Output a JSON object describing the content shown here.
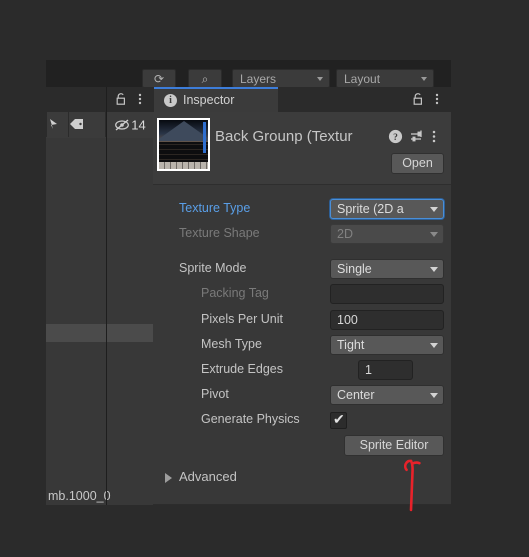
{
  "app": {
    "name": "Unity Editor",
    "background_color": "#2b2b2b",
    "panel_color": "#383838",
    "accent_color": "#3d7dd9"
  },
  "toolbar": {
    "buttons": [
      {
        "name": "cloud-sync-icon",
        "label": "⟳"
      },
      {
        "name": "search-icon",
        "label": "⌕"
      }
    ],
    "dropdowns": [
      {
        "name": "layers-dropdown",
        "label": "Layers"
      },
      {
        "name": "layout-dropdown",
        "label": "Layout"
      }
    ]
  },
  "hierarchy_panel": {
    "lock_icon": "lock-icon",
    "menu_icon": "kebab-menu-icon",
    "tool_cells": [
      {
        "name": "gizmo-icon",
        "label": "✦"
      },
      {
        "name": "tag-icon",
        "label": "⬢"
      },
      {
        "name": "visibility-off-icon",
        "label": "14"
      }
    ],
    "bottom_label": "mb.1000_0"
  },
  "inspector": {
    "tab": {
      "label": "Inspector",
      "icon": "info-icon",
      "icon_glyph": "i"
    },
    "lock_icon": "lock-icon",
    "menu_icon": "kebab-menu-icon",
    "asset": {
      "title": "Back Grounp (Textur",
      "thumbnail": "texture-thumbnail",
      "help_icon": "help-icon",
      "preset_icon": "preset-icon",
      "menu_icon": "kebab-menu-icon",
      "open_button": "Open"
    },
    "properties": [
      {
        "key": "texture_type",
        "label": "Texture Type",
        "label_style": "blue",
        "control": "popup",
        "value": "Sprite (2D a",
        "focused": true,
        "disabled": false
      },
      {
        "key": "texture_shape",
        "label": "Texture Shape",
        "label_style": "dim",
        "control": "popup",
        "value": "2D",
        "focused": false,
        "disabled": true
      },
      {
        "key": "sprite_mode",
        "label": "Sprite Mode",
        "label_style": "normal",
        "control": "popup",
        "value": "Single",
        "focused": false,
        "disabled": false
      },
      {
        "key": "packing_tag",
        "label": "Packing Tag",
        "label_style": "dim",
        "control": "text",
        "value": ""
      },
      {
        "key": "pixels_per_unit",
        "label": "Pixels Per Unit",
        "label_style": "normal",
        "control": "text",
        "value": "100"
      },
      {
        "key": "mesh_type",
        "label": "Mesh Type",
        "label_style": "normal",
        "control": "popup",
        "value": "Tight",
        "focused": false,
        "disabled": false
      },
      {
        "key": "extrude_edges",
        "label": "Extrude Edges",
        "label_style": "normal",
        "control": "slider-text",
        "value": "1"
      },
      {
        "key": "pivot",
        "label": "Pivot",
        "label_style": "normal",
        "control": "popup",
        "value": "Center",
        "focused": false,
        "disabled": false
      },
      {
        "key": "generate_physics",
        "label": "Generate Physics",
        "label_style": "normal",
        "control": "checkbox",
        "value": "✔",
        "checked": true
      }
    ],
    "sprite_editor_button": "Sprite Editor",
    "advanced_foldout": {
      "label": "Advanced",
      "expanded": false,
      "icon": "foldout-arrow-icon"
    }
  },
  "annotation": {
    "name": "red-arrow-annotation",
    "color": "#e8222a",
    "points_to": "Sprite Editor"
  }
}
